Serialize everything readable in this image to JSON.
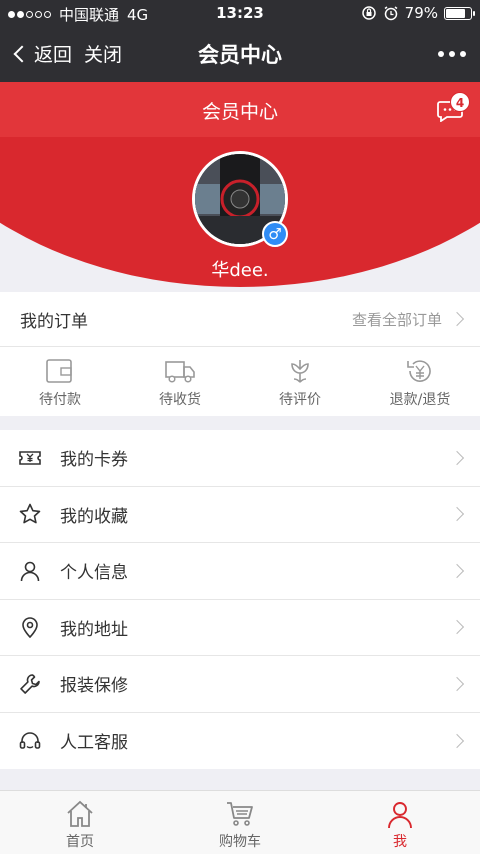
{
  "status": {
    "carrier": "中国联通",
    "network": "4G",
    "time": "13:23",
    "battery": "79%",
    "battery_fill": 0.79
  },
  "nav": {
    "back_label": "返回",
    "close_label": "关闭",
    "title": "会员中心"
  },
  "hero": {
    "title": "会员中心",
    "message_count": "4",
    "username": "华dee.",
    "gender_symbol": "♂",
    "bg_color": "#d9282e"
  },
  "orders": {
    "title": "我的订单",
    "view_all": "查看全部订单",
    "items": [
      {
        "label": "待付款",
        "icon": "wallet-icon"
      },
      {
        "label": "待收货",
        "icon": "truck-icon"
      },
      {
        "label": "待评价",
        "icon": "flower-icon"
      },
      {
        "label": "退款/退货",
        "icon": "refund-icon"
      }
    ]
  },
  "menu": {
    "items": [
      {
        "label": "我的卡券",
        "icon": "coupon-icon"
      },
      {
        "label": "我的收藏",
        "icon": "star-icon"
      },
      {
        "label": "个人信息",
        "icon": "person-icon"
      },
      {
        "label": "我的地址",
        "icon": "location-icon"
      },
      {
        "label": "报装保修",
        "icon": "wrench-icon"
      },
      {
        "label": "人工客服",
        "icon": "headset-icon"
      }
    ]
  },
  "tabbar": {
    "items": [
      {
        "label": "首页",
        "icon": "home-icon"
      },
      {
        "label": "购物车",
        "icon": "cart-icon"
      },
      {
        "label": "我",
        "icon": "user-icon",
        "active": true
      }
    ],
    "active_color": "#d9282e"
  }
}
